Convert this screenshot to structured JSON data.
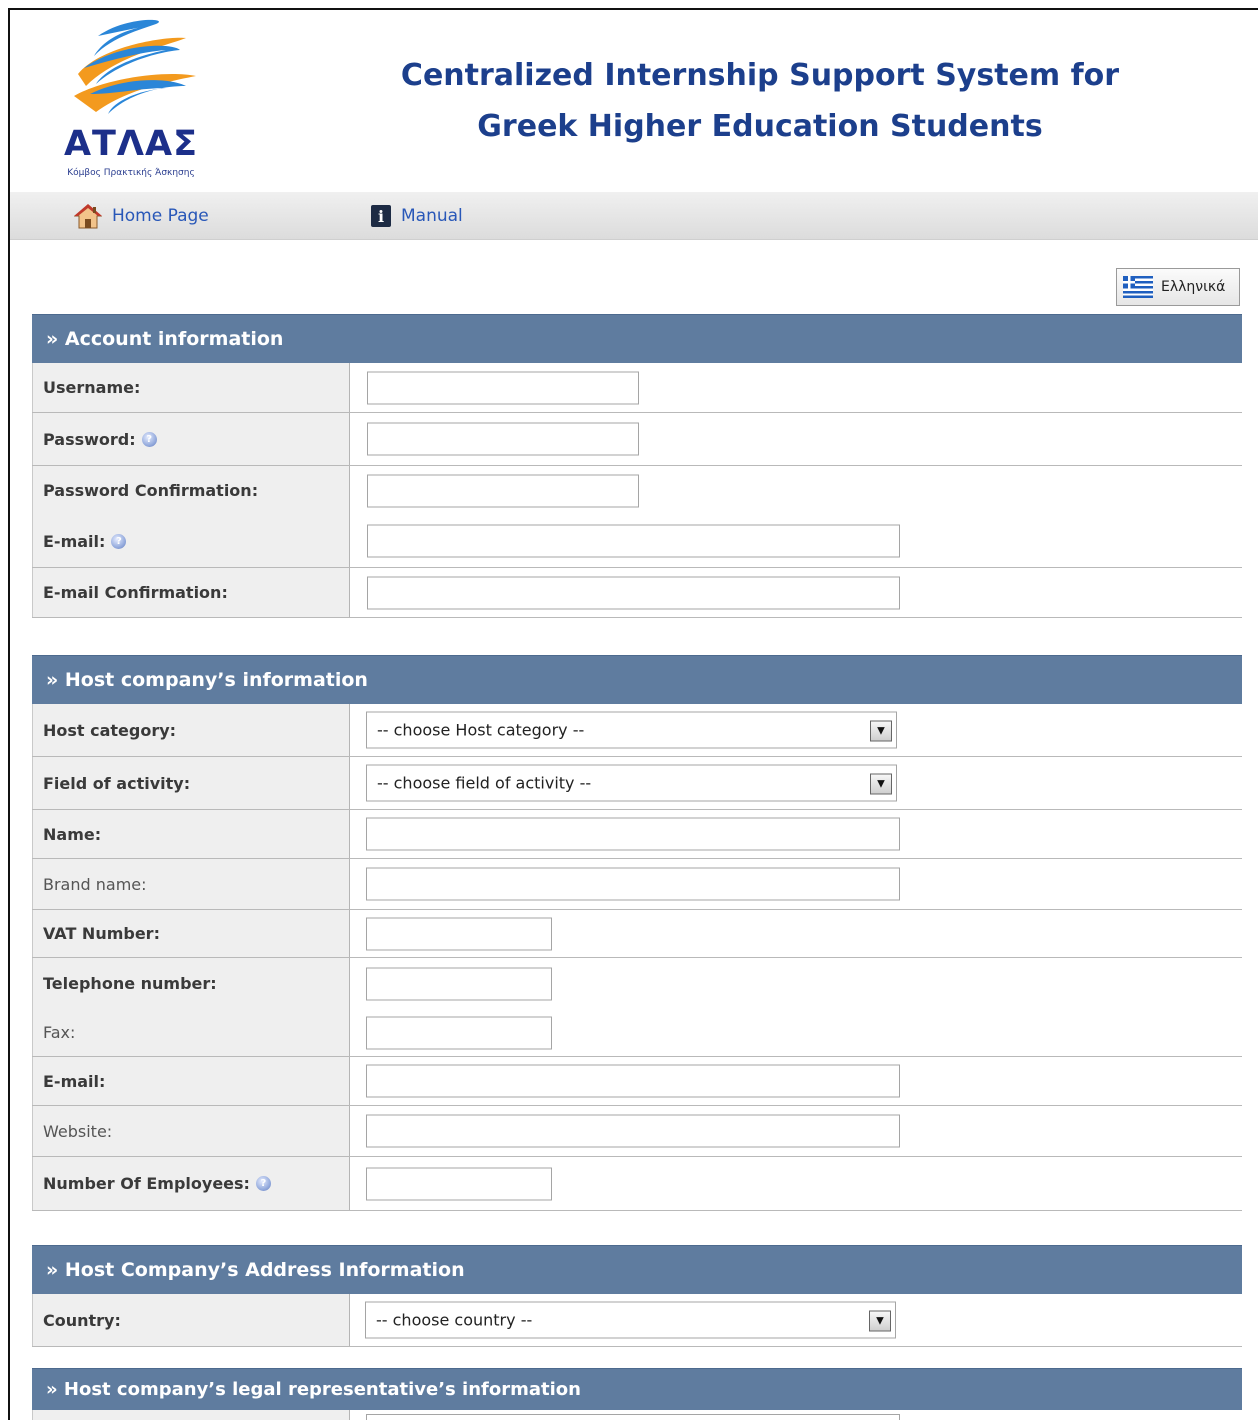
{
  "header": {
    "logo_name": "ΑΤΛΑΣ",
    "logo_subtitle": "Κόμβος Πρακτικής Άσκησης",
    "title_line1": "Centralized Internship Support System for",
    "title_line2": "Greek Higher Education Students"
  },
  "nav": {
    "home": "Home Page",
    "manual": "Manual"
  },
  "language_button": "Ελληνικά",
  "account": {
    "title": "» Account information",
    "username": "Username:",
    "password": "Password:",
    "password_confirm": "Password Confirmation:",
    "email": "E-mail:",
    "email_confirm": "E-mail Confirmation:"
  },
  "company": {
    "title": "» Host company’s information",
    "host_category": "Host category:",
    "host_category_value": "-- choose Host category --",
    "field": "Field of activity:",
    "field_value": "-- choose field of activity --",
    "name": "Name:",
    "brand": "Brand name:",
    "vat": "VAT Number:",
    "phone": "Telephone number:",
    "fax": "Fax:",
    "email": "E-mail:",
    "website": "Website:",
    "employees": "Number Of Employees:"
  },
  "address": {
    "title": "» Host Company’s Address Information",
    "country": "Country:",
    "country_value": "-- choose country --"
  },
  "legal": {
    "title": "» Host company’s legal representative’s information"
  }
}
